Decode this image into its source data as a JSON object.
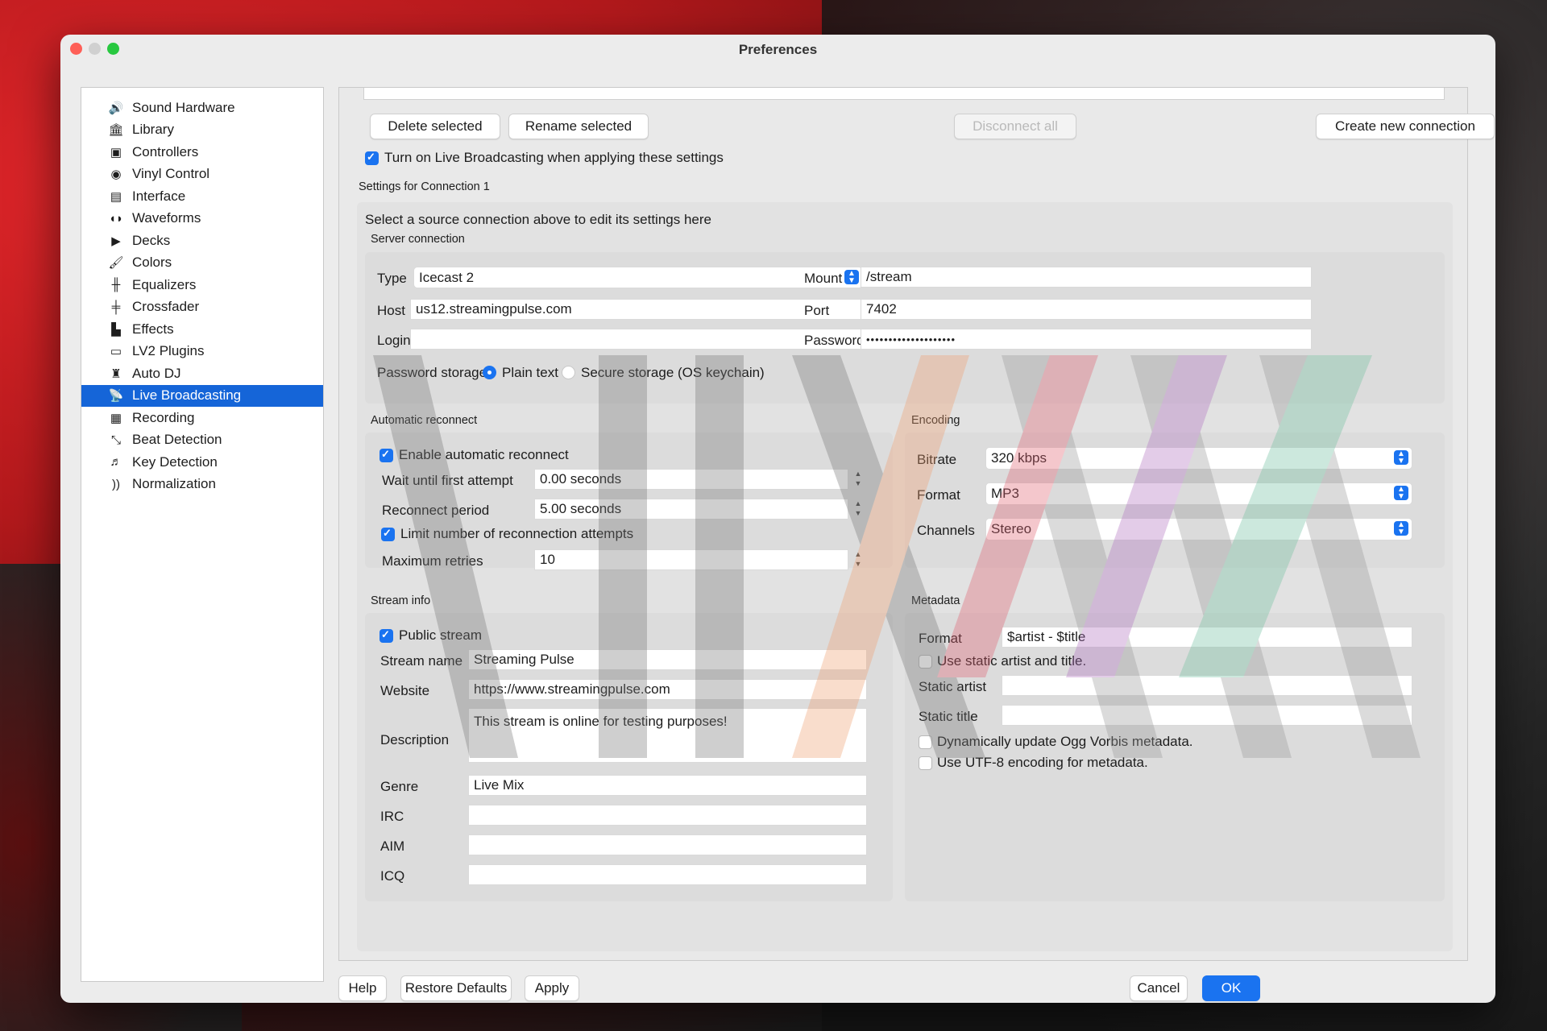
{
  "window": {
    "title": "Preferences"
  },
  "sidebar": {
    "items": [
      {
        "label": "Sound Hardware",
        "icon": "speaker-icon",
        "glyph": "🔊"
      },
      {
        "label": "Library",
        "icon": "library-icon",
        "glyph": "🏛"
      },
      {
        "label": "Controllers",
        "icon": "controller-icon",
        "glyph": "▣"
      },
      {
        "label": "Vinyl Control",
        "icon": "vinyl-icon",
        "glyph": "◉"
      },
      {
        "label": "Interface",
        "icon": "interface-icon",
        "glyph": "▤"
      },
      {
        "label": "Waveforms",
        "icon": "waveform-icon",
        "glyph": "◖◗"
      },
      {
        "label": "Decks",
        "icon": "play-icon",
        "glyph": "▶"
      },
      {
        "label": "Colors",
        "icon": "brush-icon",
        "glyph": "🖌"
      },
      {
        "label": "Equalizers",
        "icon": "equalizer-icon",
        "glyph": "╫"
      },
      {
        "label": "Crossfader",
        "icon": "crossfader-icon",
        "glyph": "╪"
      },
      {
        "label": "Effects",
        "icon": "effects-icon",
        "glyph": "▙"
      },
      {
        "label": "LV2 Plugins",
        "icon": "lv2-icon",
        "glyph": "▭"
      },
      {
        "label": "Auto DJ",
        "icon": "autodj-icon",
        "glyph": "♜"
      },
      {
        "label": "Live Broadcasting",
        "icon": "broadcast-icon",
        "glyph": "📡"
      },
      {
        "label": "Recording",
        "icon": "recording-icon",
        "glyph": "▦"
      },
      {
        "label": "Beat Detection",
        "icon": "beat-icon",
        "glyph": "⤡"
      },
      {
        "label": "Key Detection",
        "icon": "key-icon",
        "glyph": "♬"
      },
      {
        "label": "Normalization",
        "icon": "normalization-icon",
        "glyph": "))"
      }
    ],
    "selected": "Live Broadcasting"
  },
  "connections": {
    "delete_label": "Delete selected",
    "rename_label": "Rename selected",
    "disconnect_label": "Disconnect all",
    "create_label": "Create new connection",
    "turn_on_label": "Turn on Live Broadcasting when applying these settings",
    "turn_on_checked": true
  },
  "settings_title": "Settings for Connection 1",
  "select_hint": "Select a source connection above to edit its settings here",
  "server": {
    "section": "Server connection",
    "type_label": "Type",
    "type_value": "Icecast 2",
    "mount_label": "Mount",
    "mount_value": "/stream",
    "host_label": "Host",
    "host_value": "us12.streamingpulse.com",
    "port_label": "Port",
    "port_value": "7402",
    "login_label": "Login",
    "login_value": "",
    "password_label": "Password",
    "password_value": "••••••••••••••••••••",
    "storage_label": "Password storage",
    "storage_plain": "Plain text",
    "storage_secure": "Secure storage (OS keychain)",
    "storage_selected": "Plain text"
  },
  "reconnect": {
    "section": "Automatic reconnect",
    "enable_label": "Enable automatic reconnect",
    "enable_checked": true,
    "wait_label": "Wait until first attempt",
    "wait_value": "0.00 seconds",
    "period_label": "Reconnect period",
    "period_value": "5.00 seconds",
    "limit_label": "Limit number of reconnection attempts",
    "limit_checked": true,
    "max_label": "Maximum retries",
    "max_value": "10"
  },
  "encoding": {
    "section": "Encoding",
    "bitrate_label": "Bitrate",
    "bitrate_value": "320 kbps",
    "format_label": "Format",
    "format_value": "MP3",
    "channels_label": "Channels",
    "channels_value": "Stereo"
  },
  "stream_info": {
    "section": "Stream info",
    "public_label": "Public stream",
    "public_checked": true,
    "name_label": "Stream name",
    "name_value": "Streaming Pulse",
    "website_label": "Website",
    "website_value": "https://www.streamingpulse.com",
    "description_label": "Description",
    "description_value": "This stream is online for testing purposes!",
    "genre_label": "Genre",
    "genre_value": "Live Mix",
    "irc_label": "IRC",
    "irc_value": "",
    "aim_label": "AIM",
    "aim_value": "",
    "icq_label": "ICQ",
    "icq_value": ""
  },
  "metadata": {
    "section": "Metadata",
    "format_label": "Format",
    "format_value": "$artist - $title",
    "static_label": "Use static artist and title.",
    "static_checked": false,
    "artist_label": "Static artist",
    "artist_value": "",
    "title_label": "Static title",
    "title_value": "",
    "ogg_label": "Dynamically update Ogg Vorbis metadata.",
    "ogg_checked": false,
    "utf8_label": "Use UTF-8 encoding for metadata.",
    "utf8_checked": false
  },
  "footer": {
    "help_label": "Help",
    "restore_label": "Restore Defaults",
    "apply_label": "Apply",
    "cancel_label": "Cancel",
    "ok_label": "OK"
  },
  "colors": {
    "accent": "#1a73f0",
    "selection": "#1565d8"
  }
}
